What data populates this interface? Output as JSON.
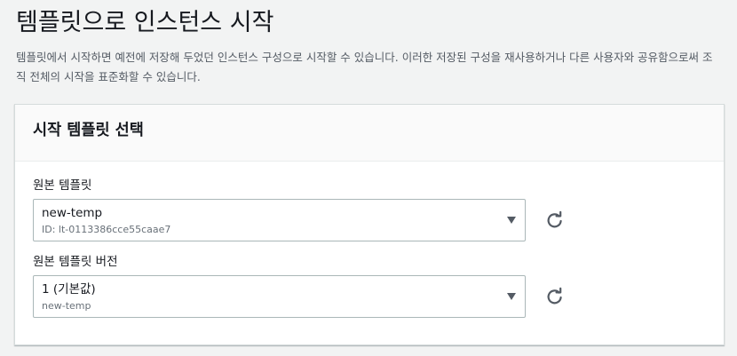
{
  "page": {
    "title": "템플릿으로 인스턴스 시작",
    "description": "템플릿에서 시작하면 예전에 저장해 두었던 인스턴스 구성으로 시작할 수 있습니다. 이러한 저장된 구성을 재사용하거나 다른 사용자와 공유함으로써 조직 전체의 시작을 표준화할 수 있습니다."
  },
  "panel": {
    "title": "시작 템플릿 선택",
    "fields": [
      {
        "label": "원본 템플릿",
        "value": "new-temp",
        "sub": "ID: lt-0113386cce55caae7",
        "icon": "refresh-icon"
      },
      {
        "label": "원본 템플릿 버전",
        "value": "1 (기본값)",
        "sub": "new-temp",
        "icon": "refresh-icon"
      }
    ]
  },
  "colors": {
    "background": "#f2f3f3",
    "panel": "#ffffff",
    "text": "#16191f",
    "muted": "#545b64",
    "border": "#aab7b8"
  }
}
